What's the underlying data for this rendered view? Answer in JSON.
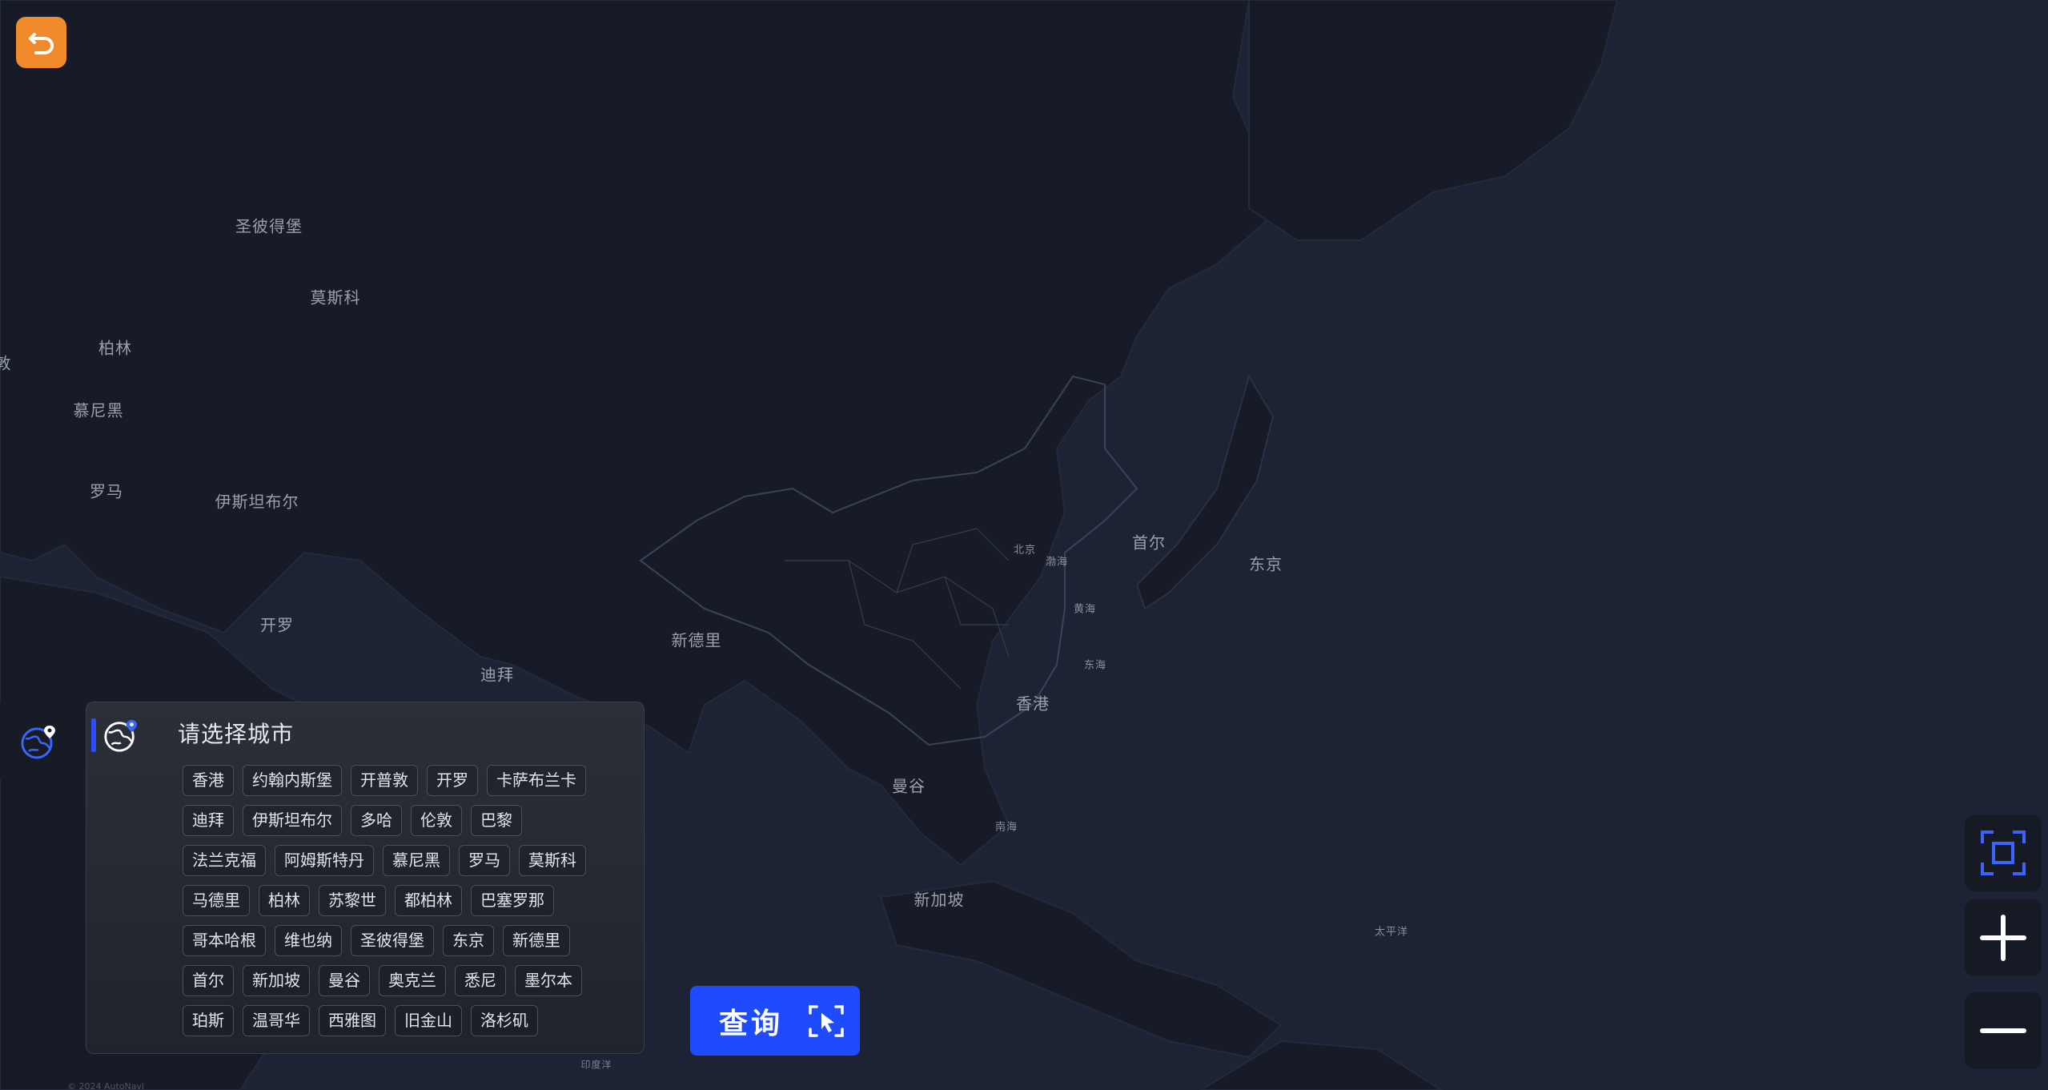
{
  "map": {
    "labels": {
      "st_petersburg": "圣彼得堡",
      "moscow": "莫斯科",
      "berlin": "柏林",
      "munich": "慕尼黑",
      "rome": "罗马",
      "istanbul": "伊斯坦布尔",
      "cairo": "开罗",
      "dubai": "迪拜",
      "new_delhi": "新德里",
      "hong_kong": "香港",
      "bangkok": "曼谷",
      "singapore": "新加坡",
      "seoul": "首尔",
      "tokyo": "东京",
      "beijing": "北京",
      "bohai": "渤海",
      "yellow_sea": "黄海",
      "east_sea": "东海",
      "south_sea": "南海",
      "pacific": "太平洋",
      "indian_ocean": "印度洋",
      "edge_partial": "敦"
    },
    "copyright": "© 2024 AutoNavi"
  },
  "panel": {
    "title": "请选择城市",
    "rows": [
      [
        "香港",
        "约翰内斯堡",
        "开普敦",
        "开罗",
        "卡萨布兰卡"
      ],
      [
        "迪拜",
        "伊斯坦布尔",
        "多哈",
        "伦敦",
        "巴黎"
      ],
      [
        "法兰克福",
        "阿姆斯特丹",
        "慕尼黑",
        "罗马",
        "莫斯科"
      ],
      [
        "马德里",
        "柏林",
        "苏黎世",
        "都柏林",
        "巴塞罗那"
      ],
      [
        "哥本哈根",
        "维也纳",
        "圣彼得堡",
        "东京",
        "新德里"
      ],
      [
        "首尔",
        "新加坡",
        "曼谷",
        "奥克兰",
        "悉尼",
        "墨尔本"
      ],
      [
        "珀斯",
        "温哥华",
        "西雅图",
        "旧金山",
        "洛杉矶"
      ]
    ]
  },
  "query_button": {
    "label": "查询"
  },
  "icons": {
    "back": "back-arrow-icon",
    "globe": "globe-pin-icon",
    "fit": "fit-screen-icon",
    "zoom_in": "plus-icon",
    "zoom_out": "minus-icon",
    "select": "cursor-select-icon"
  },
  "colors": {
    "accent_orange": "#f08a2a",
    "accent_blue": "#1f4bff",
    "map_bg": "#1b2130"
  }
}
